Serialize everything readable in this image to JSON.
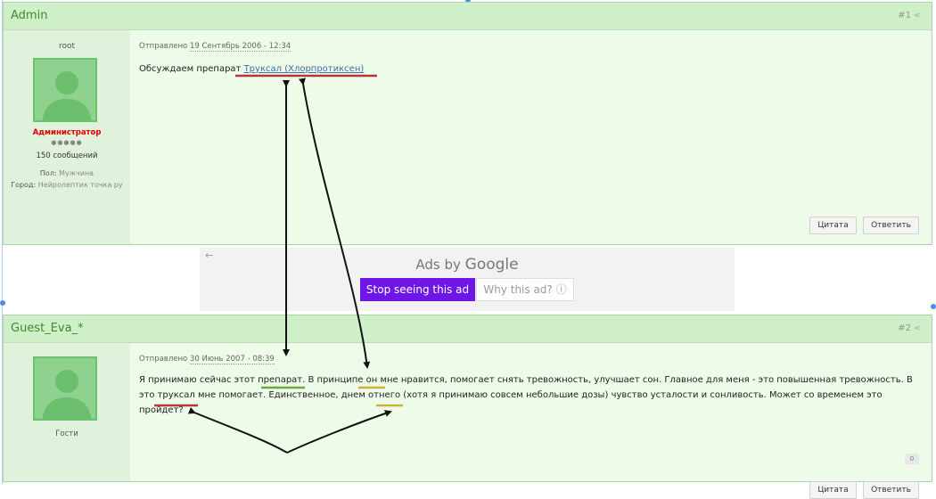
{
  "post1": {
    "author": "Admin",
    "number": "#1",
    "user": {
      "name": "root",
      "role": "Администратор",
      "stars": "●●●●●",
      "messages": "150 сообщений",
      "gender_label": "Пол:",
      "gender": "Мужчина",
      "city_label": "Город:",
      "city": "Нейролептик точка ру"
    },
    "meta_prefix": "Отправлено",
    "date": "19 Сентябрь 2006 - 12:34",
    "text_prefix": "Обсуждаем препарат ",
    "link": "Труксал (Хлорпротиксен)",
    "quote_button": "Цитата",
    "reply_button": "Ответить"
  },
  "ads": {
    "back_arrow": "←",
    "label_prefix": "Ads by ",
    "label_brand": "Google",
    "stop_button": "Stop seeing this ad",
    "why_button": "Why this ad? ⓘ"
  },
  "post2": {
    "author": "Guest_Eva_*",
    "number": "#2",
    "user": {
      "group": "Гости"
    },
    "meta_prefix": "Отправлено",
    "date": "30 Июнь 2007 - 08:39",
    "text_line1": "Я принимаю сейчас этот препарат. В принципе он мне нравится, помогает снять тревожность, улучшает сон. Главное для меня - это повышенная тревожность. В",
    "text_line2": "это труксал мне помогает. Единственное, днем отнего (хотя я принимаю совсем небольшие дозы) чувство усталости и сонливость. Может со временем это",
    "text_line3": "пройдет?",
    "rep_count": "0",
    "quote_button": "Цитата",
    "reply_button": "Ответить"
  },
  "colors": {
    "header_bg": "#cfefc9",
    "author_green": "#3c8c2a",
    "role_red": "#e00000",
    "stop_purple": "#6e16e6",
    "underline_red": "#b5363a",
    "underline_green": "#6aaa3a",
    "underline_yellow": "#c9b43a"
  },
  "icons": {
    "share": "share-icon",
    "avatar": "default-avatar-silhouette"
  }
}
